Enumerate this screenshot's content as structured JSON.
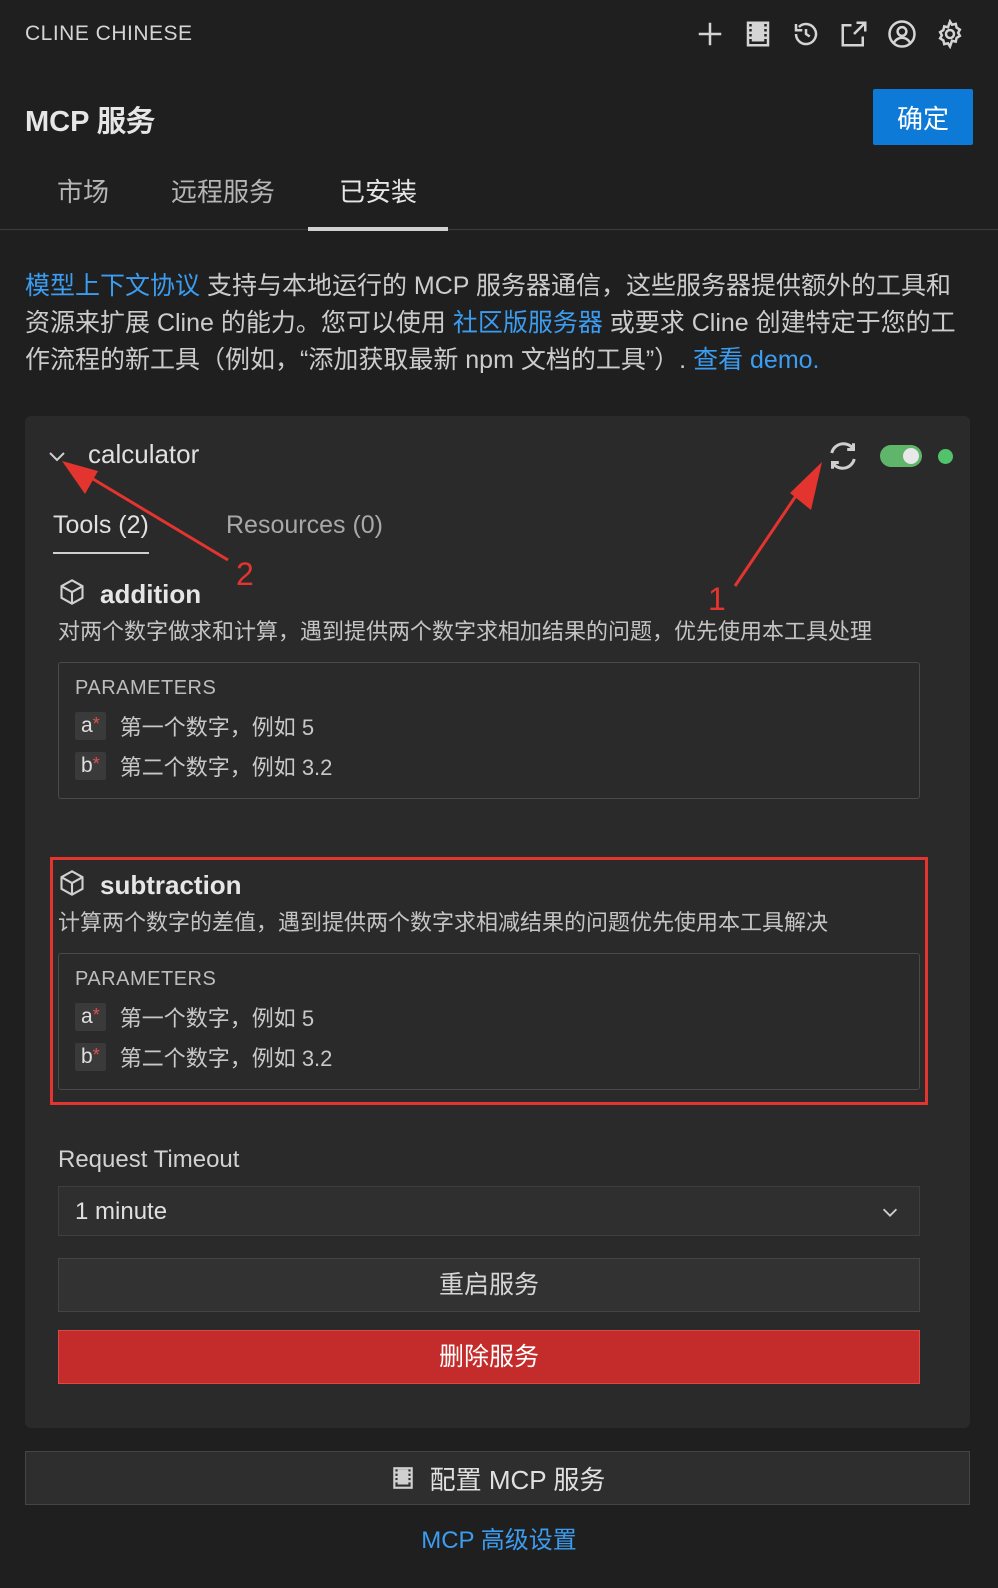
{
  "app": {
    "title": "CLINE CHINESE"
  },
  "toolbar": {
    "icons": [
      "plus-icon",
      "server-list-icon",
      "history-icon",
      "external-link-icon",
      "account-icon",
      "gear-icon"
    ]
  },
  "header": {
    "title": "MCP 服务",
    "confirm_label": "确定"
  },
  "tabs": [
    {
      "label": "市场",
      "active": false
    },
    {
      "label": "远程服务",
      "active": false
    },
    {
      "label": "已安装",
      "active": true
    }
  ],
  "intro": {
    "link1": "模型上下文协议",
    "text1": " 支持与本地运行的 MCP 服务器通信，这些服务器提供额外的工具和资源来扩展 Cline 的能力。您可以使用 ",
    "link2": "社区版服务器",
    "text2": " 或要求 Cline 创建特定于您的工作流程的新工具（例如，“添加获取最新 npm 文档的工具”）. ",
    "link3": "查看 demo."
  },
  "server": {
    "name": "calculator",
    "enabled": true,
    "status_color": "#52c36a",
    "subtabs": {
      "tools": "Tools (2)",
      "resources": "Resources (0)"
    },
    "tools": [
      {
        "name": "addition",
        "description": "对两个数字做求和计算，遇到提供两个数字求相加结果的问题，优先使用本工具处理",
        "params_title": "PARAMETERS",
        "params": [
          {
            "name": "a",
            "required_mark": "*",
            "description": "第一个数字，例如 5"
          },
          {
            "name": "b",
            "required_mark": "*",
            "description": "第二个数字，例如 3.2"
          }
        ]
      },
      {
        "name": "subtraction",
        "description": "计算两个数字的差值，遇到提供两个数字求相减结果的问题优先使用本工具解决",
        "params_title": "PARAMETERS",
        "params": [
          {
            "name": "a",
            "required_mark": "*",
            "description": "第一个数字，例如 5"
          },
          {
            "name": "b",
            "required_mark": "*",
            "description": "第二个数字，例如 3.2"
          }
        ]
      }
    ],
    "timeout": {
      "label": "Request Timeout",
      "value": "1 minute"
    },
    "restart_label": "重启服务",
    "delete_label": "删除服务"
  },
  "footer": {
    "config_label": "配置 MCP 服务",
    "advanced_label": "MCP 高级设置"
  },
  "annotations": {
    "label1": "1",
    "label2": "2",
    "color": "#e3342f"
  }
}
